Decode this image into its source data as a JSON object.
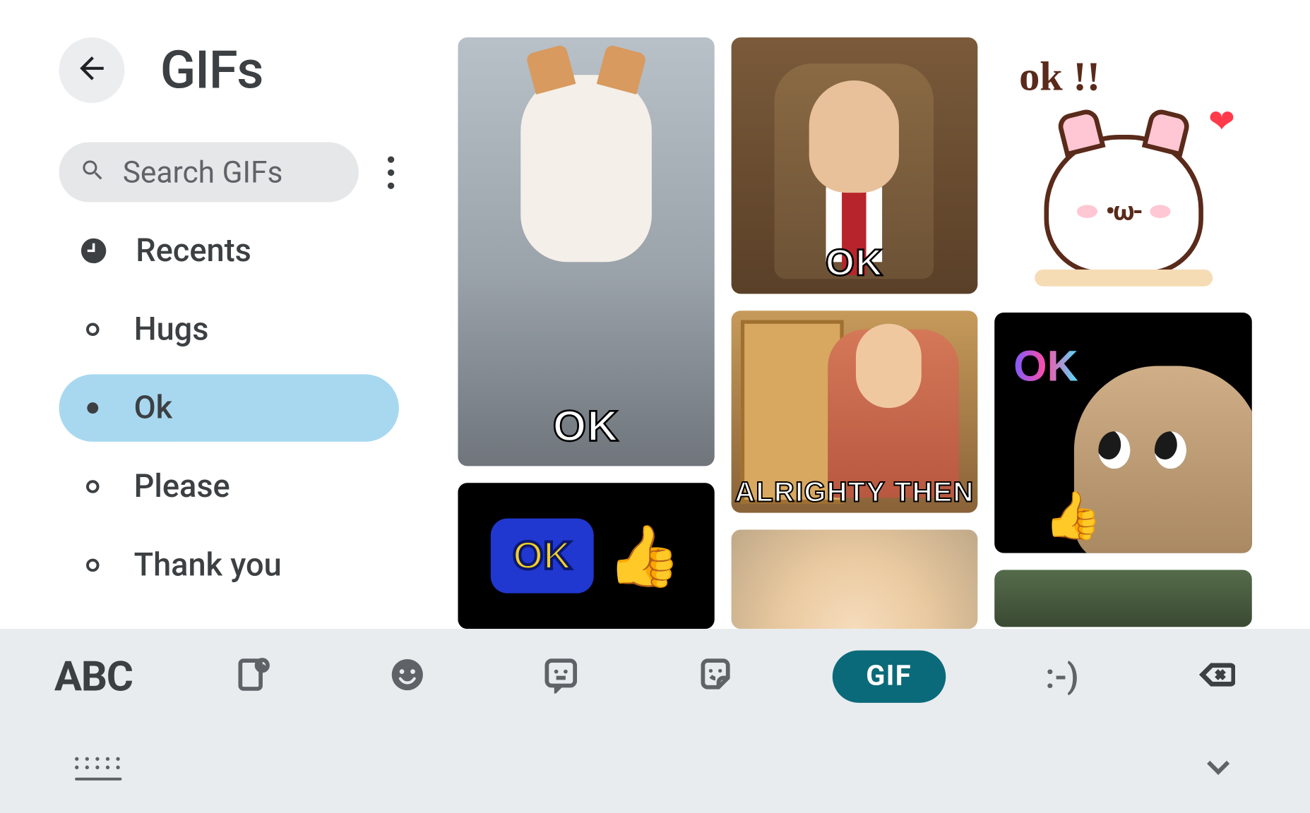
{
  "header": {
    "title": "GIFs"
  },
  "search": {
    "placeholder": "Search GIFs"
  },
  "categories": [
    {
      "id": "recents",
      "label": "Recents",
      "icon": "clock",
      "active": false
    },
    {
      "id": "hugs",
      "label": "Hugs",
      "icon": "ring",
      "active": false
    },
    {
      "id": "ok",
      "label": "Ok",
      "icon": "dot",
      "active": true
    },
    {
      "id": "please",
      "label": "Please",
      "icon": "ring",
      "active": false
    },
    {
      "id": "thankyou",
      "label": "Thank you",
      "icon": "ring",
      "active": false
    }
  ],
  "gifs": {
    "col1": [
      {
        "id": "cat-standing-ok",
        "caption": "OK"
      },
      {
        "id": "ok-thumbs-sign",
        "caption": "OK"
      }
    ],
    "col2": [
      {
        "id": "mr-bean-ok",
        "caption": "OK"
      },
      {
        "id": "alrighty-then",
        "caption": "ALRIGHTY THEN"
      },
      {
        "id": "forehead-closeup",
        "caption": ""
      }
    ],
    "col3": [
      {
        "id": "mochi-cat-ok",
        "caption": "ok !!"
      },
      {
        "id": "sad-cat-thumbs",
        "caption": "OK"
      },
      {
        "id": "man-nodding",
        "caption": ""
      }
    ]
  },
  "bottom_tabs": {
    "abc": "ABC",
    "gif_label": "GIF",
    "emoticon_label": ":-)",
    "active": "gif"
  }
}
